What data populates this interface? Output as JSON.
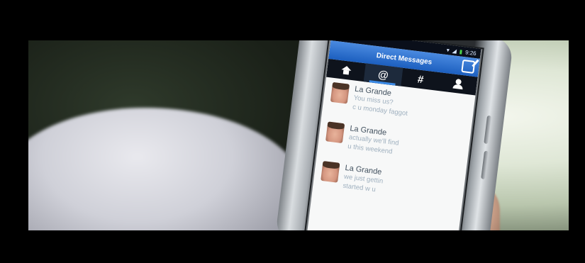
{
  "status_bar": {
    "time": "9:26",
    "icons": [
      "wifi-icon",
      "signal-icon",
      "battery-icon"
    ]
  },
  "header": {
    "title": "Direct Messages",
    "compose_icon": "compose-icon"
  },
  "tabs": [
    {
      "name": "home",
      "icon": "home-icon"
    },
    {
      "name": "mentions",
      "label": "@"
    },
    {
      "name": "hashtags",
      "label": "#"
    },
    {
      "name": "profile",
      "icon": "person-icon"
    }
  ],
  "messages": [
    {
      "sender": "La Grande",
      "lines": [
        "You miss us?",
        "c u monday faggot"
      ]
    },
    {
      "sender": "La Grande",
      "lines": [
        "actually we'll find",
        "u this weekend"
      ]
    },
    {
      "sender": "La Grande",
      "lines": [
        "we just gettin",
        "started w u"
      ]
    }
  ],
  "colors": {
    "accent": "#1c5fbf",
    "tab_bar": "#0e131c"
  }
}
